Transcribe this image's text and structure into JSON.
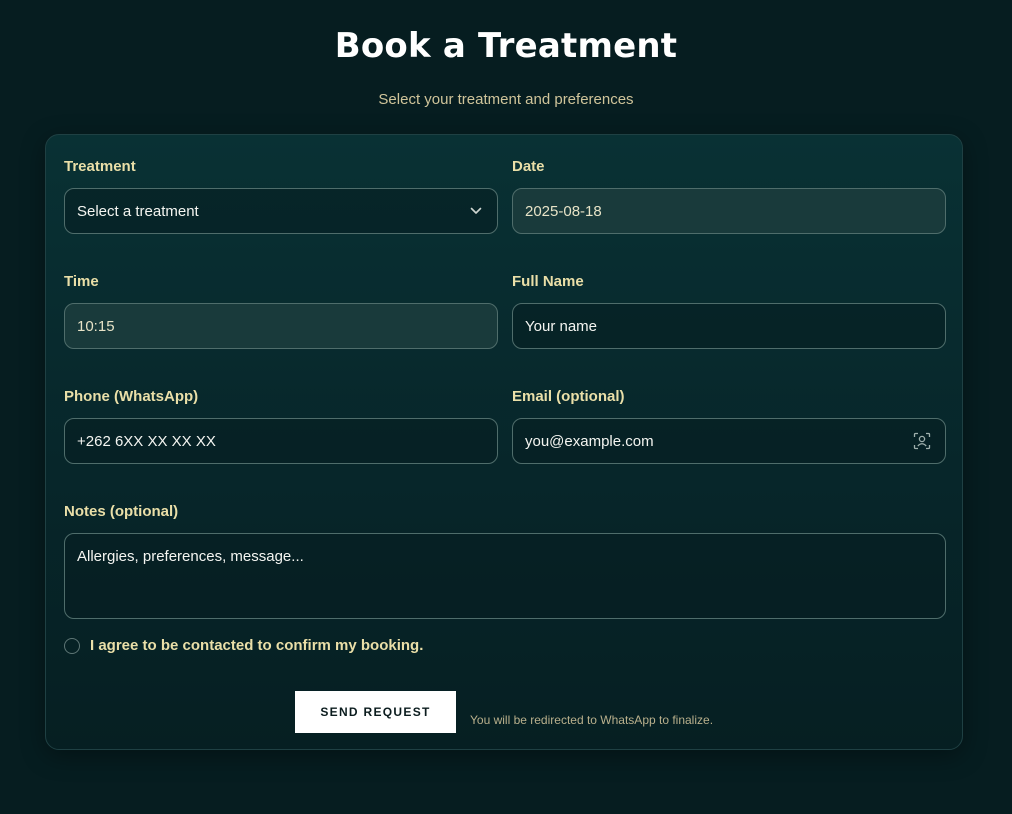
{
  "header": {
    "title": "Book a Treatment",
    "subtitle": "Select your treatment and preferences"
  },
  "form": {
    "treatment": {
      "label": "Treatment",
      "placeholder": "Select a treatment",
      "icon": "chevron-down-icon"
    },
    "date": {
      "label": "Date",
      "value": "2025-08-18"
    },
    "time": {
      "label": "Time",
      "value": "10:15"
    },
    "full_name": {
      "label": "Full Name",
      "placeholder": "Your name"
    },
    "phone": {
      "label": "Phone (WhatsApp)",
      "placeholder": "+262 6XX XX XX XX"
    },
    "email": {
      "label": "Email (optional)",
      "placeholder": "you@example.com",
      "icon": "contact-card-icon"
    },
    "notes": {
      "label": "Notes (optional)",
      "placeholder": "Allergies, preferences, message..."
    },
    "consent": {
      "label": "I agree to be contacted to confirm my booking.",
      "checked": false
    },
    "submit": {
      "label": "SEND REQUEST",
      "note": "You will be redirected to WhatsApp to finalize."
    }
  },
  "colors": {
    "background": "#061d20",
    "card": "#093134",
    "label": "#eadfa8",
    "button": "#ffffff"
  }
}
